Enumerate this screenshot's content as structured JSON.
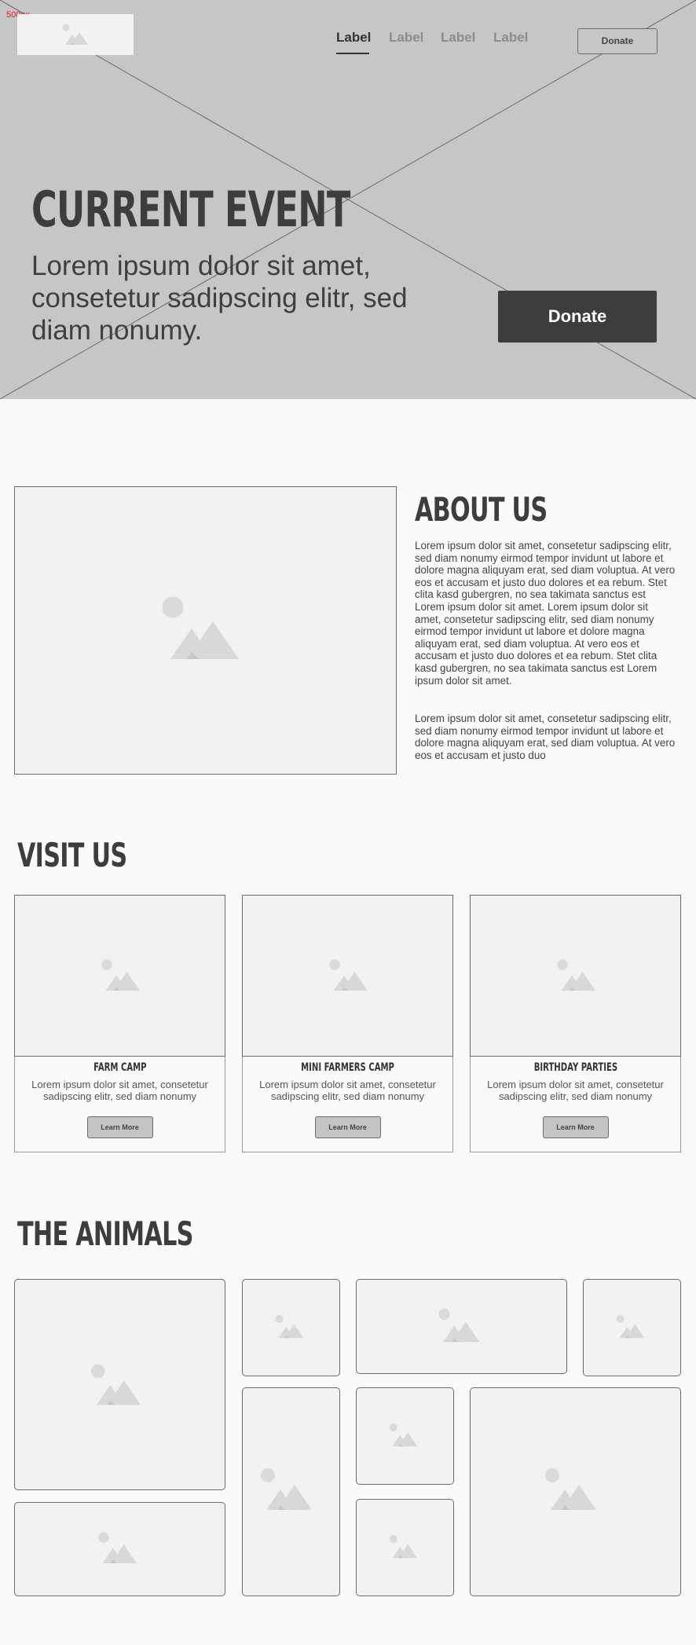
{
  "corner_note": "500px",
  "nav": {
    "items": [
      {
        "label": "Label",
        "active": true
      },
      {
        "label": "Label",
        "active": false
      },
      {
        "label": "Label",
        "active": false
      },
      {
        "label": "Label",
        "active": false
      }
    ],
    "donate_label": "Donate"
  },
  "hero": {
    "title": "CURRENT EVENT",
    "subtitle": "Lorem ipsum dolor sit amet, consetetur sadipscing elitr, sed diam nonumy.",
    "donate_label": "Donate"
  },
  "about": {
    "title": "ABOUT US",
    "paragraph1": "Lorem ipsum dolor sit amet, consetetur sadipscing elitr, sed diam nonumy eirmod tempor invidunt ut labore et dolore magna aliquyam erat, sed diam voluptua. At vero eos et accusam et justo duo dolores et ea rebum. Stet clita kasd gubergren, no sea takimata sanctus est Lorem ipsum dolor sit amet. Lorem ipsum dolor sit amet, consetetur sadipscing elitr, sed diam nonumy eirmod tempor invidunt ut labore et dolore magna aliquyam erat, sed diam voluptua. At vero eos et accusam et justo duo dolores et ea rebum. Stet clita kasd gubergren, no sea takimata sanctus est Lorem ipsum dolor sit amet.",
    "paragraph2": "Lorem ipsum dolor sit amet, consetetur sadipscing elitr, sed diam nonumy eirmod tempor invidunt ut labore et dolore magna aliquyam erat, sed diam voluptua. At vero eos et accusam et justo duo"
  },
  "visit": {
    "title": "VISIT US",
    "cards": [
      {
        "title": "FARM CAMP",
        "desc": "Lorem ipsum dolor sit amet, consetetur sadipscing elitr, sed diam nonumy",
        "button": "Learn More"
      },
      {
        "title": "MINI FARMERS CAMP",
        "desc": "Lorem ipsum dolor sit amet, consetetur sadipscing elitr, sed diam nonumy",
        "button": "Learn More"
      },
      {
        "title": "BIRTHDAY PARTIES",
        "desc": "Lorem ipsum dolor sit amet, consetetur sadipscing elitr, sed diam nonumy",
        "button": "Learn More"
      }
    ]
  },
  "animals": {
    "title": "THE ANIMALS"
  },
  "colors": {
    "hero_bg": "#c6c6c6",
    "dark_button": "#3d3d3d",
    "page_bg": "#fafafa",
    "placeholder_bg": "#f2f2f2",
    "note": "#e02020"
  },
  "icons": {
    "image_placeholder": "image-placeholder-icon"
  }
}
